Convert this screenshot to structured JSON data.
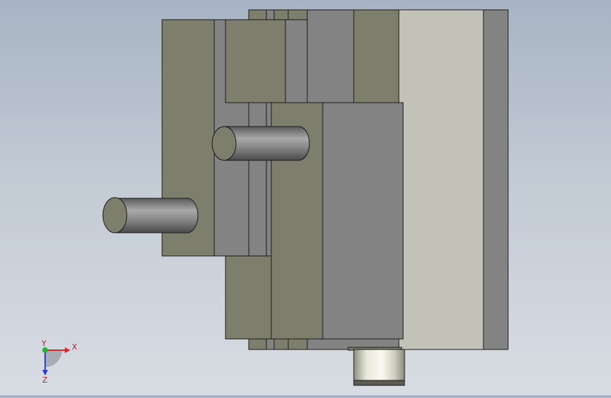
{
  "viewport": {
    "title": "",
    "colors": {
      "body_dark": "#7d7e6b",
      "body_gray": "#838383",
      "body_light": "#c2c2b9",
      "edge": "#1a1a1a",
      "background_top": "#a8b4c4",
      "background_bottom": "#d8dde3"
    }
  },
  "triad": {
    "x_label": "X",
    "y_label": "Y",
    "z_label": "Z",
    "x_color": "#d8262a",
    "y_color": "#22b13a",
    "z_color": "#2a3fd8"
  }
}
